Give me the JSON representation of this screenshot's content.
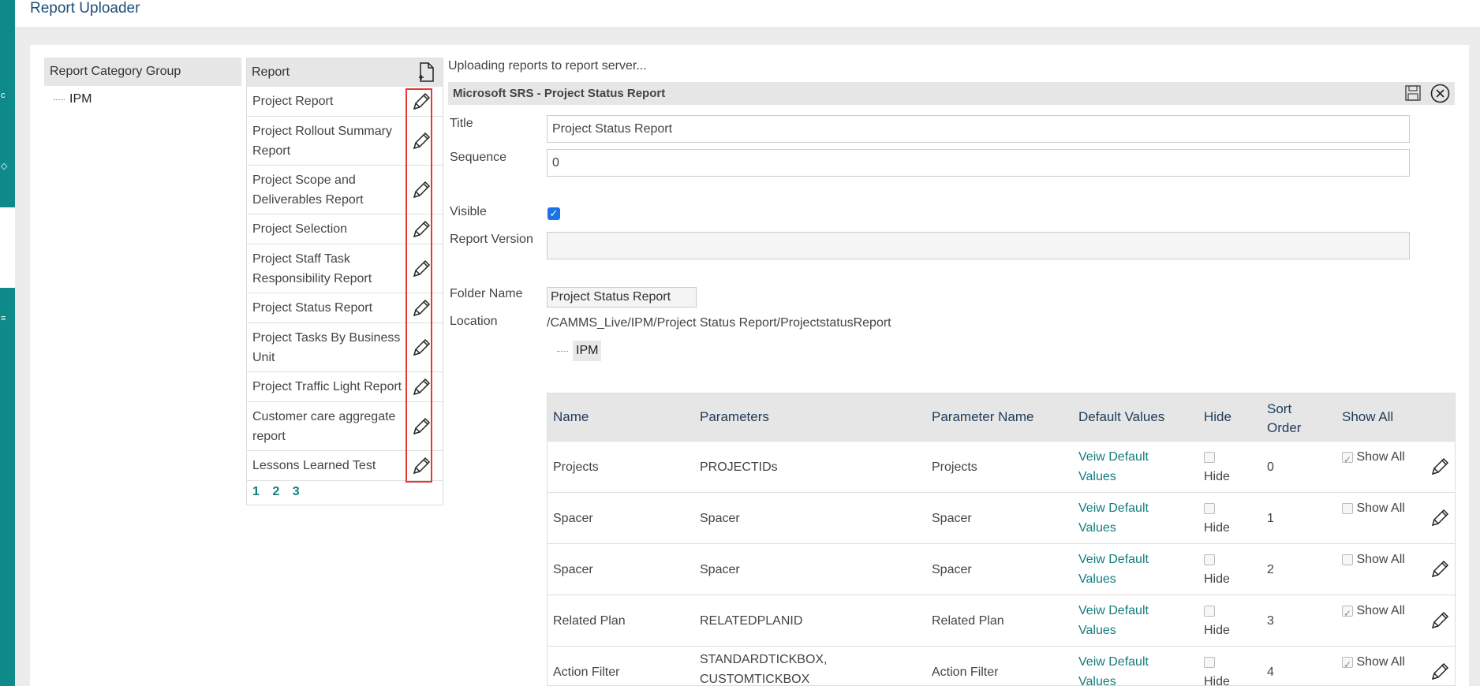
{
  "app": {
    "title": "Report Uploader"
  },
  "category_panel": {
    "header": "Report Category Group",
    "items": [
      "IPM"
    ]
  },
  "report_panel": {
    "header": "Report",
    "items": [
      "Project Report",
      "Project Rollout Summary Report",
      "Project Scope and Deliverables Report",
      "Project Selection",
      "Project Staff Task Responsibility Report",
      "Project Status Report",
      "Project Tasks By Business Unit",
      "Project Traffic Light Report",
      "Customer care aggregate report",
      "Lessons Learned Test"
    ],
    "pages": [
      "1",
      "2",
      "3"
    ]
  },
  "detail": {
    "status": "Uploading reports to report server...",
    "header": "Microsoft SRS - Project Status Report",
    "title_label": "Title",
    "title_value": "Project Status Report",
    "sequence_label": "Sequence",
    "sequence_value": "0",
    "visible_label": "Visible",
    "visible_checked": true,
    "version_label": "Report Version",
    "version_value": "",
    "folder_label": "Folder Name",
    "folder_value": "Project Status Report",
    "location_label": "Location",
    "location_value": "/CAMMS_Live/IPM/Project Status Report/ProjectstatusReport",
    "tree_item": "IPM"
  },
  "params": {
    "headers": {
      "name": "Name",
      "parameters": "Parameters",
      "param_name": "Parameter Name",
      "defaults": "Default Values",
      "hide": "Hide",
      "sort_order": "Sort Order",
      "show_all": "Show All"
    },
    "hide_label": "Hide",
    "show_all_label": "Show All",
    "default_link": "Veiw Default Values",
    "rows": [
      {
        "name": "Projects",
        "parameters": "PROJECTIDs",
        "param_name": "Projects",
        "sort": "0",
        "hide": false,
        "show_all": true
      },
      {
        "name": "Spacer",
        "parameters": "Spacer",
        "param_name": "Spacer",
        "sort": "1",
        "hide": false,
        "show_all": false
      },
      {
        "name": "Spacer",
        "parameters": "Spacer",
        "param_name": "Spacer",
        "sort": "2",
        "hide": false,
        "show_all": false
      },
      {
        "name": "Related Plan",
        "parameters": "RELATEDPLANID",
        "param_name": "Related Plan",
        "sort": "3",
        "hide": false,
        "show_all": true
      },
      {
        "name": "Action Filter",
        "parameters": "STANDARDTICKBOX, CUSTOMTICKBOX",
        "param_name": "Action Filter",
        "sort": "4",
        "hide": false,
        "show_all": true
      }
    ]
  }
}
